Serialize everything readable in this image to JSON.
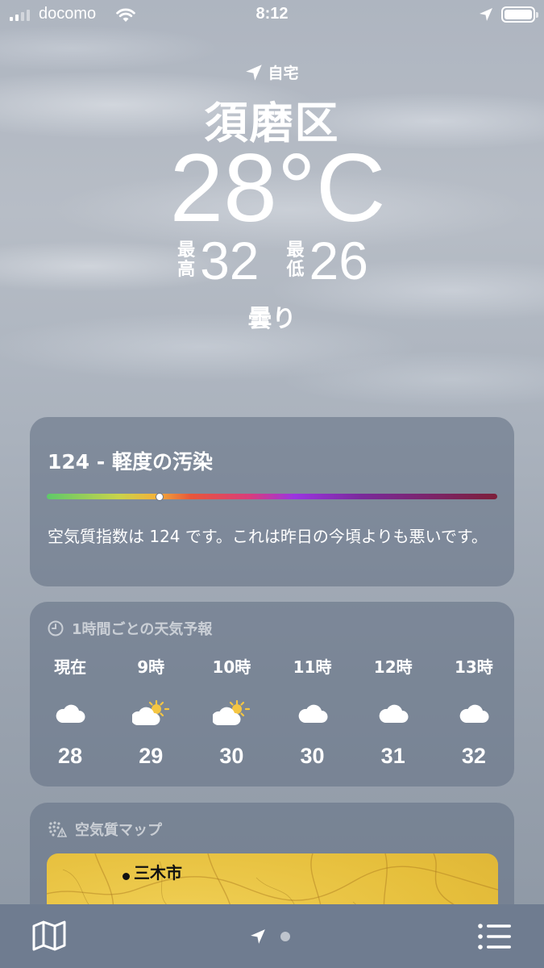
{
  "status_bar": {
    "carrier": "docomo",
    "time": "8:12"
  },
  "header": {
    "home_label": "自宅",
    "city": "須磨区",
    "temperature": "28°C",
    "high_label": "最高",
    "high": "32",
    "low_label": "最低",
    "low": "26",
    "condition": "曇り"
  },
  "air_quality": {
    "title": "124 - 軽度の汚染",
    "index_fraction": 0.25,
    "description": "空気質指数は 124 です。これは昨日の今頃よりも悪いです。"
  },
  "hourly": {
    "header": "1時間ごとの天気予報",
    "items": [
      {
        "time": "現在",
        "icon": "cloud-icon",
        "temp": "28"
      },
      {
        "time": "9時",
        "icon": "sun-behind-cloud-icon",
        "temp": "29"
      },
      {
        "time": "10時",
        "icon": "sun-behind-cloud-icon",
        "temp": "30"
      },
      {
        "time": "11時",
        "icon": "cloud-icon",
        "temp": "30"
      },
      {
        "time": "12時",
        "icon": "cloud-icon",
        "temp": "31"
      },
      {
        "time": "13時",
        "icon": "cloud-icon",
        "temp": "32"
      }
    ]
  },
  "air_map": {
    "header": "空気質マップ",
    "city_label": "三木市"
  },
  "colors": {
    "card_bg": "#687488",
    "bottom_bar": "#6f7c90",
    "map_yellow": "#e6bf3c"
  }
}
